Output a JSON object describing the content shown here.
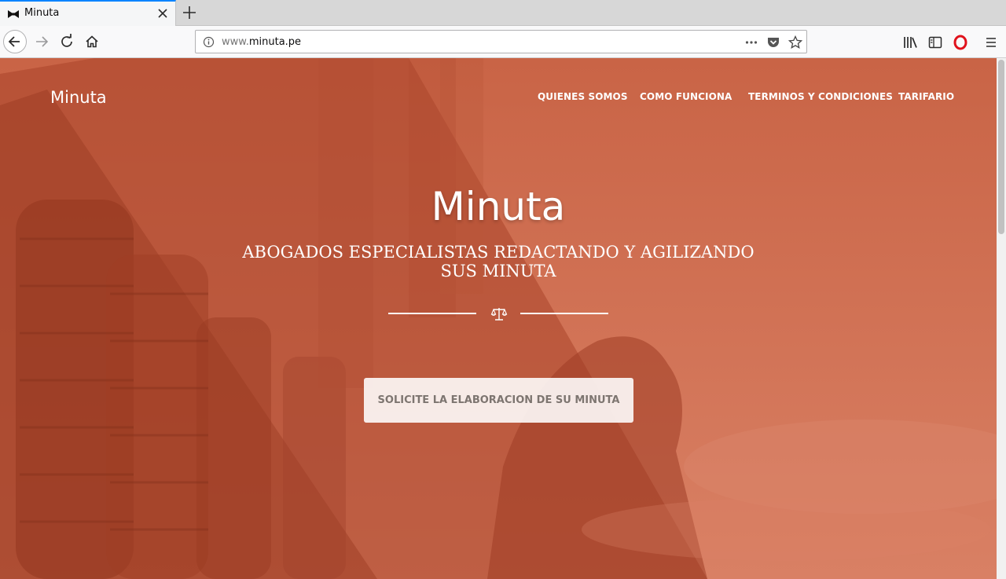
{
  "browser": {
    "tab": {
      "title": "Minuta",
      "favicon": "bowtie-icon"
    },
    "url": {
      "prefix": "www.",
      "host": "minuta.pe"
    },
    "accent": "#0a84ff"
  },
  "site": {
    "brand": "Minuta",
    "nav": [
      {
        "label": "QUIENES SOMOS"
      },
      {
        "label": "COMO FUNCIONA"
      },
      {
        "label": "TERMINOS Y CONDICIONES"
      },
      {
        "label": "TARIFARIO"
      }
    ],
    "hero": {
      "title": "Minuta",
      "subtitle": "ABOGADOS ESPECIALISTAS REDACTANDO Y AGILIZANDO SUS MINUTA",
      "divider_icon": "balance-scale-icon",
      "cta": "SOLICITE LA ELABORACION DE SU MINUTA"
    },
    "colors": {
      "overlay": "#c8603f",
      "text": "#ffffff",
      "cta_text": "#7d7570"
    }
  }
}
